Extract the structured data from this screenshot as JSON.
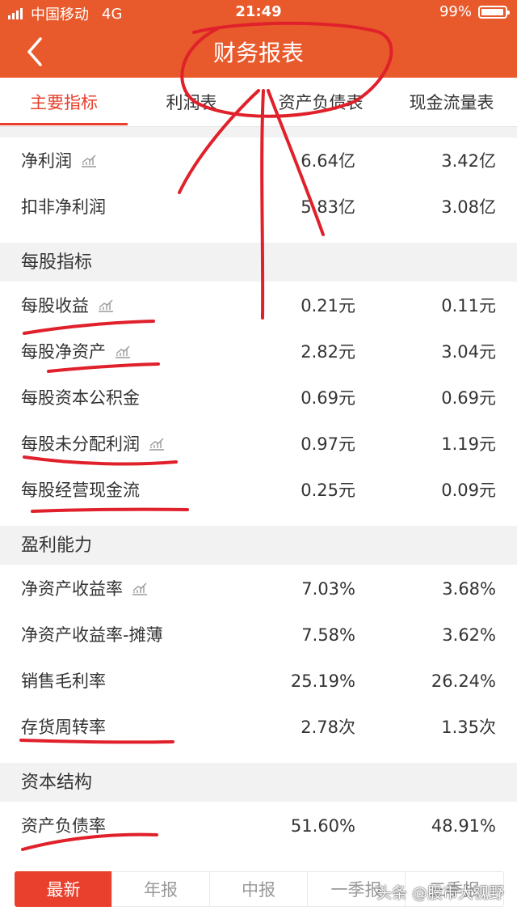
{
  "status_bar": {
    "carrier": "中国移动",
    "network": "4G",
    "time": "21:49",
    "battery": "99%"
  },
  "nav": {
    "title": "财务报表",
    "back_icon": "chevron-left-icon"
  },
  "tabs": [
    {
      "label": "主要指标",
      "active": true
    },
    {
      "label": "利润表",
      "active": false
    },
    {
      "label": "资产负债表",
      "active": false
    },
    {
      "label": "现金流量表",
      "active": false
    }
  ],
  "rows_top": [
    {
      "label": "净利润",
      "trend": true,
      "v1": "6.64亿",
      "v2": "3.42亿"
    },
    {
      "label": "扣非净利润",
      "trend": false,
      "v1": "5.83亿",
      "v2": "3.08亿"
    }
  ],
  "sections": [
    {
      "title": "每股指标",
      "rows": [
        {
          "label": "每股收益",
          "trend": true,
          "v1": "0.21元",
          "v2": "0.11元"
        },
        {
          "label": "每股净资产",
          "trend": true,
          "v1": "2.82元",
          "v2": "3.04元"
        },
        {
          "label": "每股资本公积金",
          "trend": false,
          "v1": "0.69元",
          "v2": "0.69元"
        },
        {
          "label": "每股未分配利润",
          "trend": true,
          "v1": "0.97元",
          "v2": "1.19元"
        },
        {
          "label": "每股经营现金流",
          "trend": false,
          "v1": "0.25元",
          "v2": "0.09元"
        }
      ]
    },
    {
      "title": "盈利能力",
      "rows": [
        {
          "label": "净资产收益率",
          "trend": true,
          "v1": "7.03%",
          "v2": "3.68%"
        },
        {
          "label": "净资产收益率-摊薄",
          "trend": false,
          "v1": "7.58%",
          "v2": "3.62%"
        },
        {
          "label": "销售毛利率",
          "trend": false,
          "v1": "25.19%",
          "v2": "26.24%"
        },
        {
          "label": "存货周转率",
          "trend": false,
          "v1": "2.78次",
          "v2": "1.35次"
        }
      ]
    },
    {
      "title": "资本结构",
      "rows": [
        {
          "label": "资产负债率",
          "trend": false,
          "v1": "51.60%",
          "v2": "48.91%"
        }
      ]
    }
  ],
  "period_tabs": [
    {
      "label": "最新",
      "active": true
    },
    {
      "label": "年报",
      "active": false
    },
    {
      "label": "中报",
      "active": false
    },
    {
      "label": "一季报",
      "active": false
    },
    {
      "label": "三季报",
      "active": false
    }
  ],
  "watermark": "头条 @股市大视野",
  "colors": {
    "brand": "#e85a2c",
    "accent": "#e8402c",
    "annotation": "#e0202a"
  }
}
